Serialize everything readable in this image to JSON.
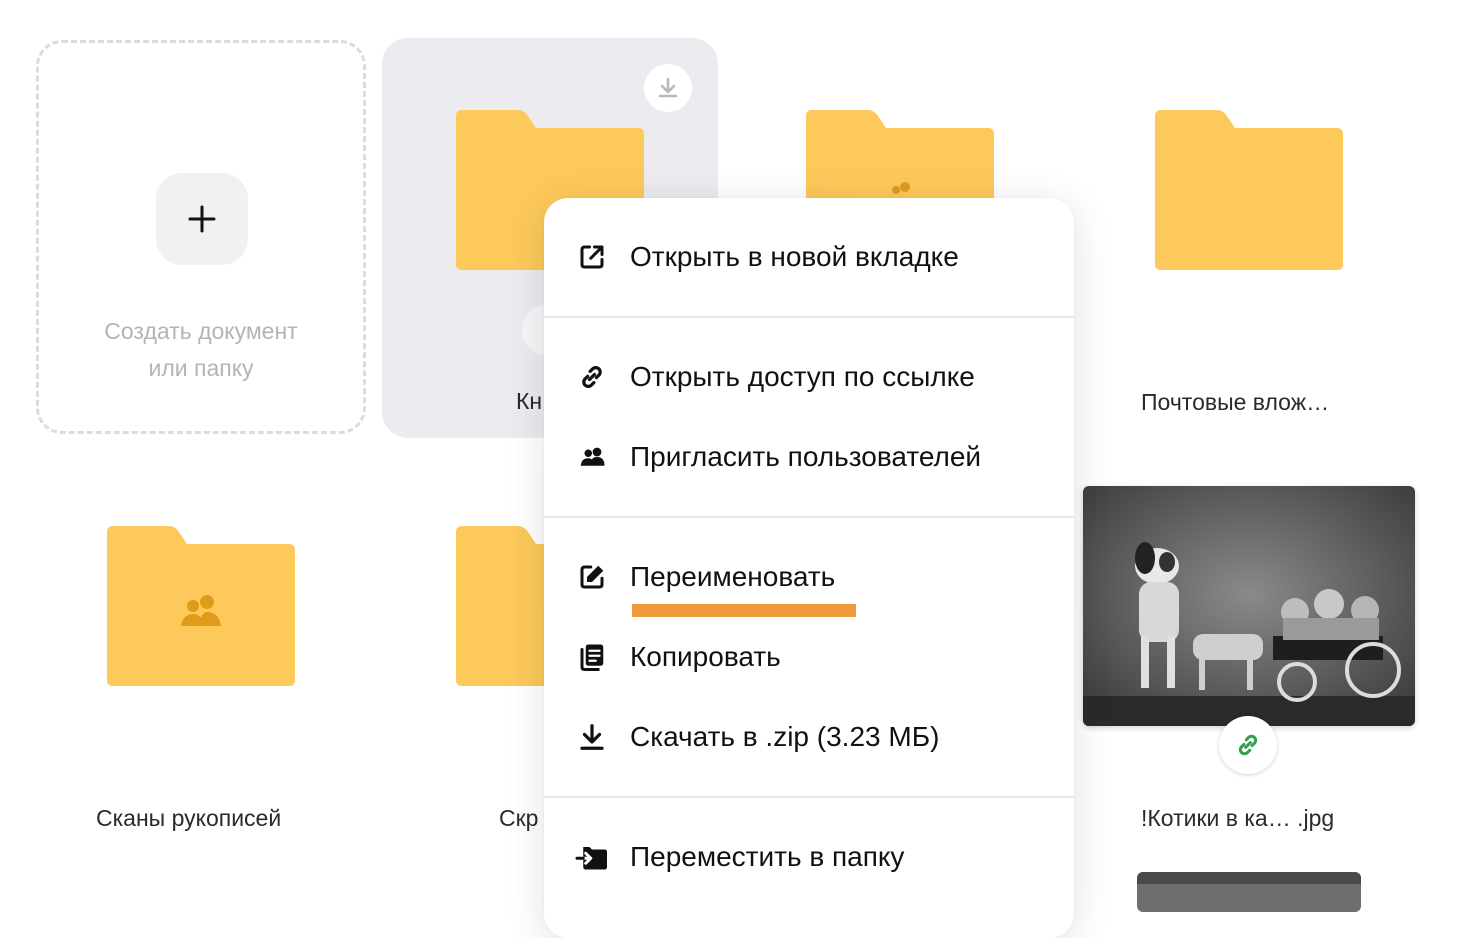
{
  "create_tile": {
    "line1": "Создать документ",
    "line2": "или папку"
  },
  "items": {
    "selected_folder": "Кн",
    "shared_folder": "",
    "mail_attachments": "Почтовые влож…",
    "scans": "Сканы рукописей",
    "screenshots": "Скр",
    "cats_photo": "!Котики в ка… .jpg"
  },
  "context_menu": {
    "open_new_tab": "Открыть в новой вкладке",
    "share_link": "Открыть доступ по ссылке",
    "invite_users": "Пригласить пользователей",
    "rename": "Переименовать",
    "copy": "Копировать",
    "download_zip": "Скачать в .zip (3.23 МБ)",
    "move_to_folder": "Переместить в папку"
  },
  "colors": {
    "folder": "#fdc95b",
    "folder_dark": "#e09b1a",
    "highlight": "#f0993a",
    "link_green": "#2fa24c"
  },
  "icons": {
    "plus": "plus-icon",
    "download": "download-icon",
    "open_new_tab": "external-link-icon",
    "share_link": "link-icon",
    "invite": "users-icon",
    "rename": "edit-icon",
    "copy": "copy-icon",
    "download_zip": "download-icon",
    "move": "move-to-folder-icon"
  }
}
